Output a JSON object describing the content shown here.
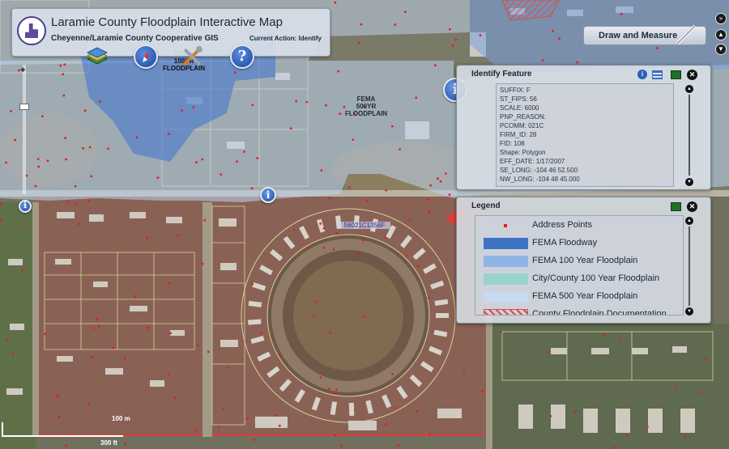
{
  "header": {
    "title": "Laramie County Floodplain Interactive Map",
    "subtitle": "Cheyenne/Laramie County Cooperative GIS",
    "current_action": "Current Action: Identify"
  },
  "toolbar": {
    "draw_measure_label": "Draw and Measure",
    "help_glyph": "?"
  },
  "map_labels": {
    "fema_100": "FEMA\n100YR\nFLOODPLAIN",
    "fema_500": "FEMA\n500YR\nFLOODPLAIN",
    "parcel_id": "56021C1356F",
    "scale_m": "100 m",
    "scale_ft": "300 ft"
  },
  "identify_panel": {
    "title": "Identify Feature",
    "rows": [
      "SUFFIX: F",
      "ST_FIPS: 56",
      "SCALE: 6000",
      "PNP_REASON:",
      "PCOMM: 021C",
      "FIRM_ID: 28",
      "FID: 108",
      "Shape: Polygon",
      "EFF_DATE: 1/17/2007",
      "SE_LONG: -104 46 52.500",
      "NW_LONG: -104 48 45.000"
    ]
  },
  "legend_panel": {
    "title": "Legend",
    "items": [
      {
        "label": "Address Points",
        "color": "#e02020",
        "kind": "dot"
      },
      {
        "label": "FEMA Floodway",
        "color": "#3e73c4",
        "kind": "fill"
      },
      {
        "label": "FEMA 100 Year Floodplain",
        "color": "#8fb4e6",
        "kind": "fill"
      },
      {
        "label": "City/County 100 Year Floodplain",
        "color": "#9ad2cc",
        "kind": "fill"
      },
      {
        "label": "FEMA 500 Year Floodplain",
        "color": "#c8daf0",
        "kind": "fill"
      },
      {
        "label": "County Floodplain Documentation",
        "color": "#e04a4a",
        "kind": "hatch"
      }
    ]
  },
  "icons": {
    "layers": "layers-icon",
    "compass": "compass-icon",
    "tools": "tools-icon",
    "help": "help-icon",
    "info": "info-icon",
    "pencil": "pencil-icon"
  }
}
